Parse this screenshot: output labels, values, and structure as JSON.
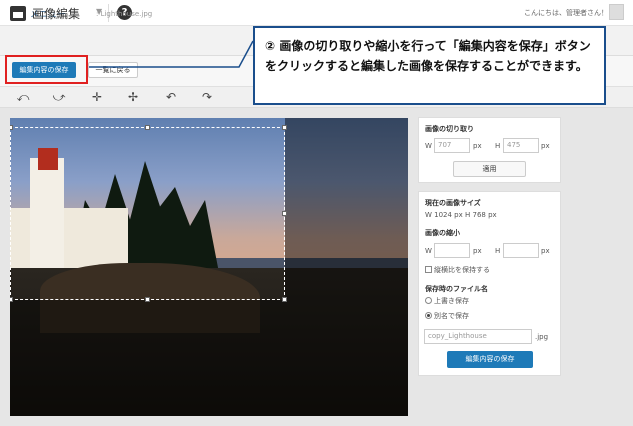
{
  "header": {
    "menu_label": "メニュー",
    "menu_caret": "▼",
    "help_glyph": "?",
    "greeting": "こんにちは、管理者さん！"
  },
  "title": {
    "page_title": "画像編集",
    "filename": ": Lighthouse.jpg"
  },
  "buttons": {
    "save_label": "編集内容の保存",
    "back_label": "一覧に戻る"
  },
  "tools": [
    {
      "name": "rotate-left-icon",
      "glyph": "⤺"
    },
    {
      "name": "rotate-right-icon",
      "glyph": "⤻"
    },
    {
      "name": "flip-horizontal-icon",
      "glyph": "✛"
    },
    {
      "name": "flip-vertical-icon",
      "glyph": "✢"
    },
    {
      "name": "undo-icon",
      "glyph": "↶"
    },
    {
      "name": "redo-icon",
      "glyph": "↷"
    }
  ],
  "crop": {
    "title": "画像の切り取り",
    "w_label": "W",
    "w_value": "707",
    "h_label": "H",
    "h_value": "475",
    "unit": "px",
    "apply_label": "適用"
  },
  "size": {
    "title": "現在の画像サイズ",
    "current": "W 1024 px   H 768 px",
    "resize_title": "画像の縮小",
    "w_label": "W",
    "h_label": "H",
    "unit": "px",
    "keep_ratio": "縦横比を保持する",
    "filename_title": "保存時のファイル名",
    "overwrite": "上書き保存",
    "save_as": "別名で保存",
    "filename_value": "copy_Lighthouse",
    "ext": ".jpg",
    "save_label": "編集内容の保存"
  },
  "callout": {
    "text": "② 画像の切り取りや縮小を行って「編集内容を保存」ボタンをクリックすると編集した画像を保存することができます。"
  },
  "colors": {
    "accent": "#1e7ab8",
    "highlight": "#e02020",
    "callout_border": "#1a4e8c"
  }
}
